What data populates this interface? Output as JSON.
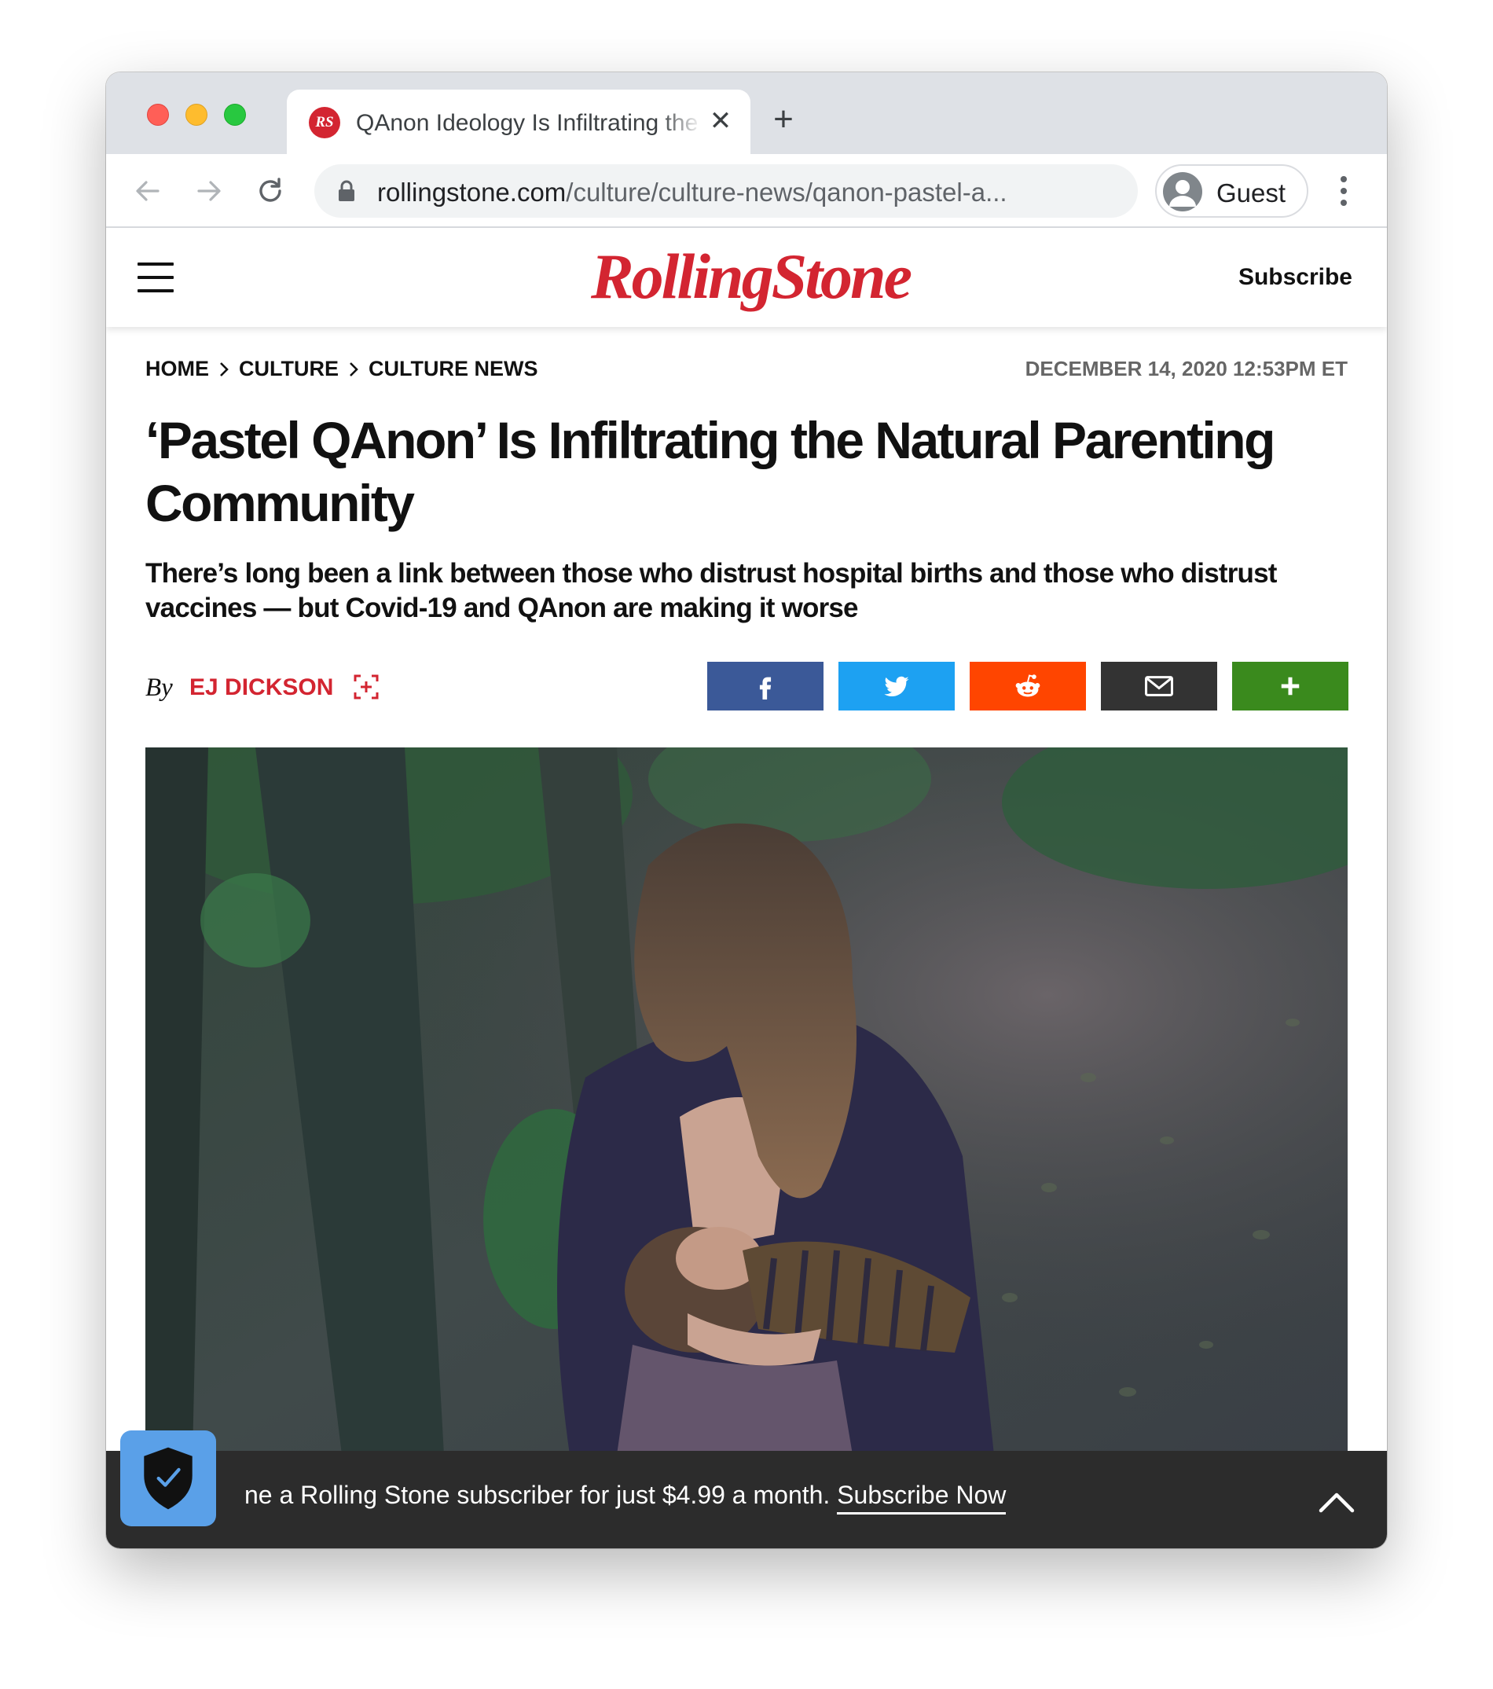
{
  "browser": {
    "tab_title": "QAnon Ideology Is Infiltrating the Natural Parenting Community",
    "tab_favicon_text": "RS",
    "url_domain": "rollingstone.com",
    "url_path": "/culture/culture-news/qanon-pastel-a...",
    "profile_label": "Guest"
  },
  "site": {
    "logo_text": "RollingStone",
    "subscribe_label": "Subscribe",
    "brand_color": "#d32531"
  },
  "breadcrumb": [
    "HOME",
    "CULTURE",
    "CULTURE NEWS"
  ],
  "article": {
    "dateline": "DECEMBER 14, 2020 12:53PM ET",
    "headline": "‘Pastel QAnon’ Is Infiltrating the Natural Parenting Community",
    "dek": "There’s long been a link between those who distrust hospital births and those who distrust vaccines — but Covid-19 and QAnon are making it worse",
    "byline_prefix": "By",
    "author": "EJ DICKSON"
  },
  "share": [
    {
      "name": "facebook",
      "icon": "facebook-icon",
      "color": "#3b5998"
    },
    {
      "name": "twitter",
      "icon": "twitter-icon",
      "color": "#1da1f2"
    },
    {
      "name": "reddit",
      "icon": "reddit-icon",
      "color": "#ff4500"
    },
    {
      "name": "email",
      "icon": "mail-icon",
      "color": "#333333"
    },
    {
      "name": "more",
      "icon": "plus-icon",
      "color": "#3a8a1d"
    }
  ],
  "promo": {
    "text": "ne a Rolling Stone subscriber for just $4.99 a month.",
    "link": "Subscribe Now"
  }
}
